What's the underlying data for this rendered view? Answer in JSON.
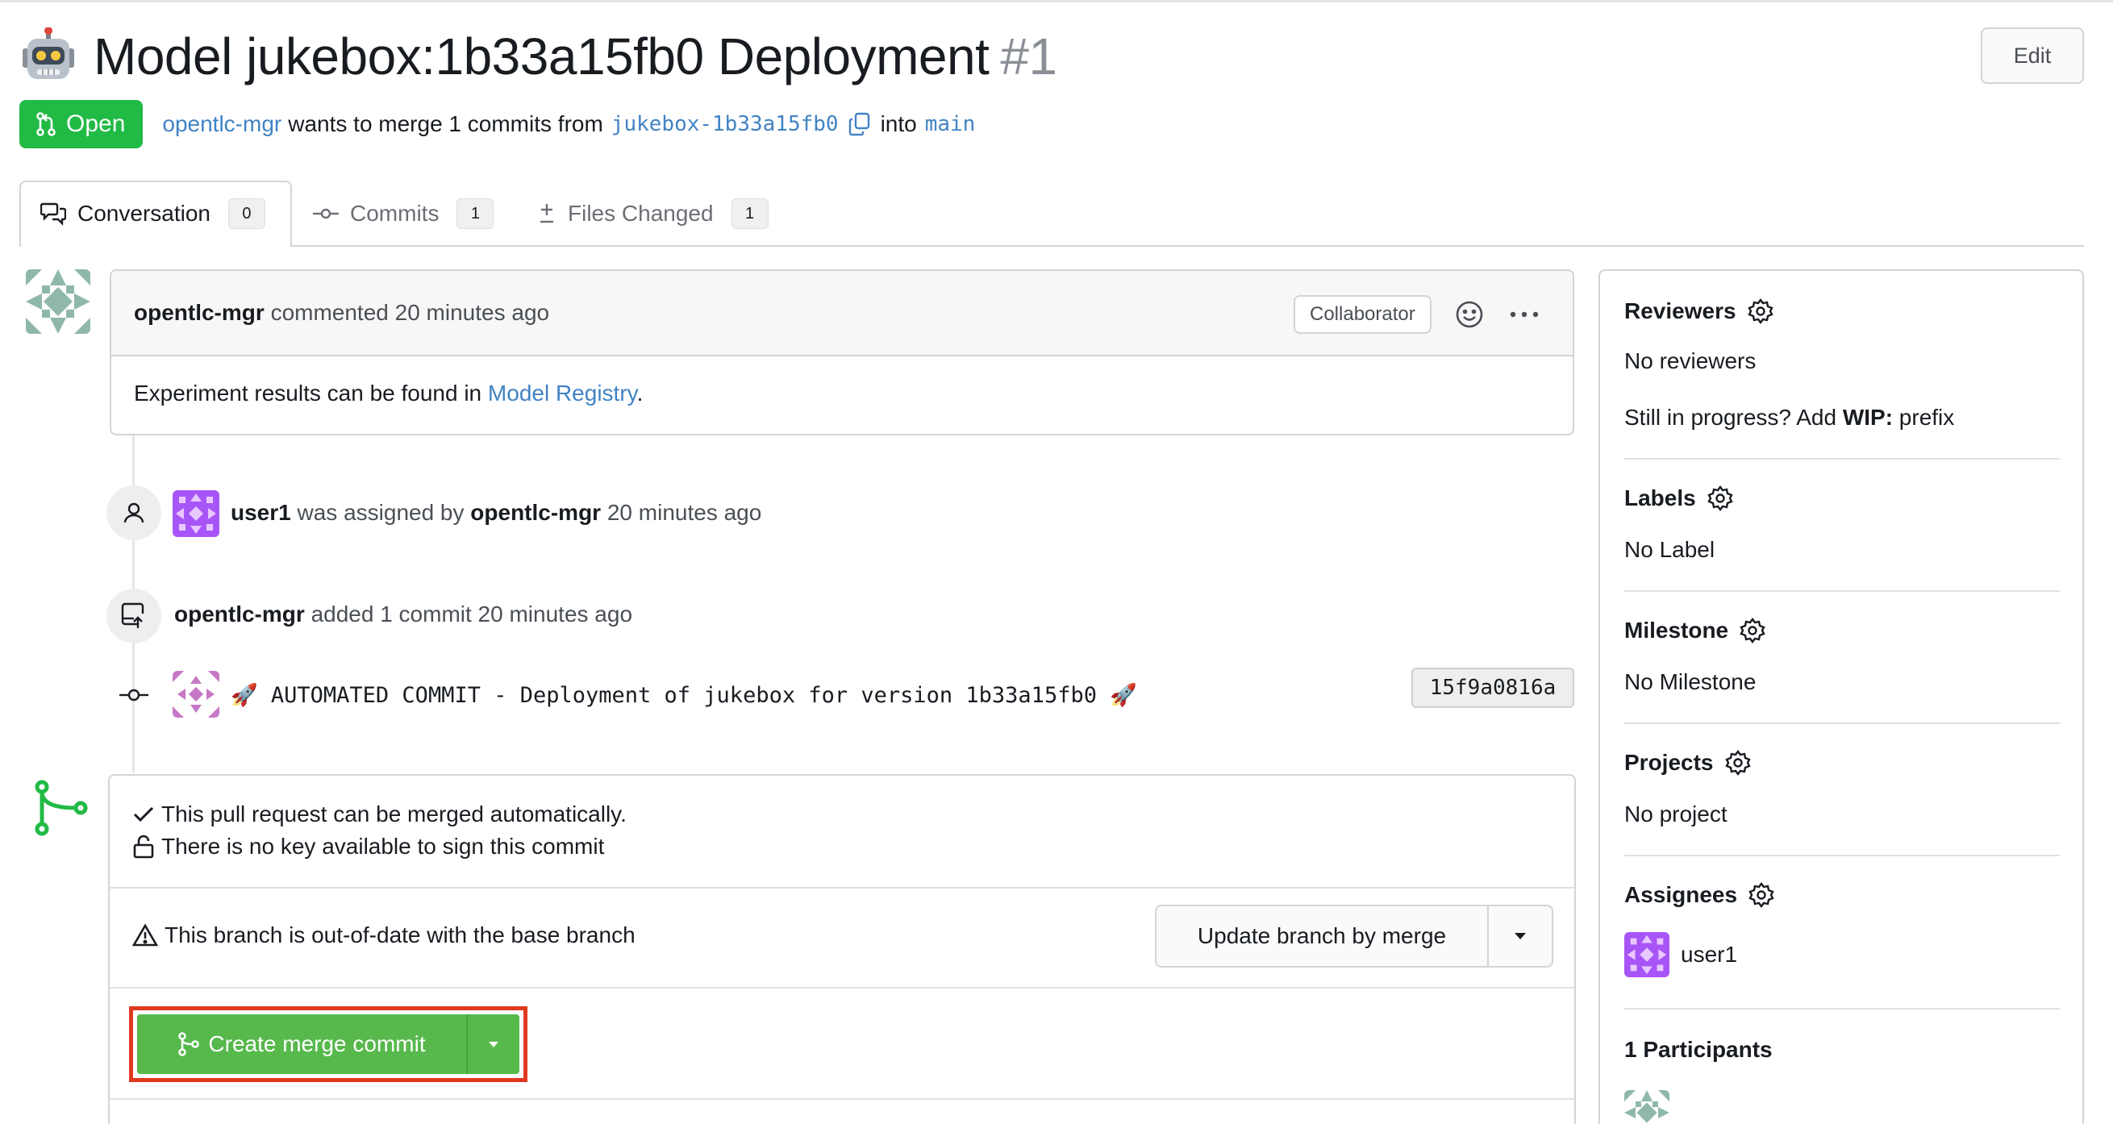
{
  "header": {
    "title_emoji": "robot-icon",
    "title": "Model jukebox:1b33a15fb0 Deployment",
    "number": "#1",
    "edit_label": "Edit"
  },
  "status": {
    "badge": "Open",
    "author": "opentlc-mgr",
    "wants_text": "wants to merge 1 commits from",
    "head_branch": "jukebox-1b33a15fb0",
    "into_text": "into",
    "base_branch": "main"
  },
  "tabs": [
    {
      "label": "Conversation",
      "count": "0",
      "icon": "conversation-icon"
    },
    {
      "label": "Commits",
      "count": "1",
      "icon": "commit-icon"
    },
    {
      "label": "Files Changed",
      "count": "1",
      "icon": "diff-icon"
    }
  ],
  "comment": {
    "author": "opentlc-mgr",
    "action": "commented 20 minutes ago",
    "role": "Collaborator",
    "body_prefix": "Experiment results can be found in ",
    "body_link": "Model Registry",
    "body_suffix": "."
  },
  "events": {
    "assigned": {
      "user": "user1",
      "text": "was assigned by",
      "by": "opentlc-mgr",
      "time": "20 minutes ago"
    },
    "added": {
      "user": "opentlc-mgr",
      "text": "added 1 commit 20 minutes ago"
    },
    "commit": {
      "message": "🚀 AUTOMATED COMMIT - Deployment of jukebox for version 1b33a15fb0 🚀",
      "sha": "15f9a0816a"
    }
  },
  "merge": {
    "can_merge": "This pull request can be merged automatically.",
    "no_key": "There is no key available to sign this commit",
    "out_of_date": "This branch is out-of-date with the base branch",
    "update_label": "Update branch by merge",
    "merge_label": "Create merge commit"
  },
  "sidebar": {
    "reviewers_title": "Reviewers",
    "reviewers_value": "No reviewers",
    "wip_prefix": "Still in progress? Add ",
    "wip_bold": "WIP:",
    "wip_suffix": " prefix",
    "labels_title": "Labels",
    "labels_value": "No Label",
    "milestone_title": "Milestone",
    "milestone_value": "No Milestone",
    "projects_title": "Projects",
    "projects_value": "No project",
    "assignees_title": "Assignees",
    "assignee": "user1",
    "participants_title": "1 Participants"
  },
  "colors": {
    "open_green": "#21ba45",
    "merge_green": "#57b94c",
    "link_blue": "#4183c4",
    "highlight_red": "#e0391f"
  }
}
